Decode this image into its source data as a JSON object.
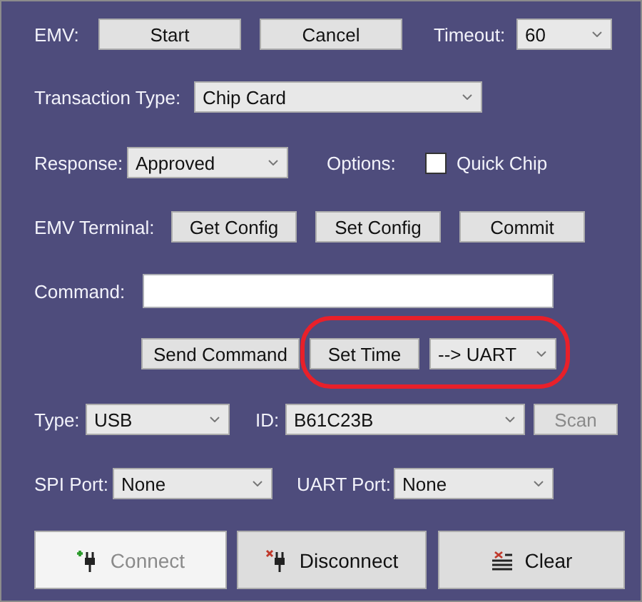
{
  "emv": {
    "label": "EMV:",
    "buttons": [
      {
        "label": "Start",
        "disabled": false
      },
      {
        "label": "Cancel",
        "disabled": false
      }
    ],
    "timeout": {
      "label": "Timeout:",
      "value": "60"
    }
  },
  "transaction_type": {
    "label": "Transaction Type:",
    "value": "Chip Card"
  },
  "response": {
    "label": "Response:",
    "value": "Approved"
  },
  "options": {
    "label": "Options:",
    "checkbox": {
      "label": "Quick Chip",
      "checked": false
    }
  },
  "emv_terminal": {
    "label": "EMV Terminal:",
    "buttons": [
      {
        "label": "Get Config",
        "disabled": false
      },
      {
        "label": "Set Config",
        "disabled": false
      },
      {
        "label": "Commit",
        "disabled": false
      }
    ]
  },
  "command": {
    "label": "Command:"
  },
  "command_actions": {
    "send_button": "Send Command",
    "set_time_button": "Set Time",
    "target": "--> UART",
    "highlighted": true
  },
  "connection": {
    "type": {
      "label": "Type:",
      "value": "USB"
    },
    "id": {
      "label": "ID:",
      "value": "B61C23B"
    },
    "scan": {
      "label": "Scan",
      "disabled": true
    },
    "spi_port": {
      "label": "SPI Port:",
      "value": "None"
    },
    "uart_port": {
      "label": "UART Port:",
      "value": "None"
    }
  },
  "actions": [
    {
      "kind": "connect",
      "label": "Connect",
      "disabled": true
    },
    {
      "kind": "disconnect",
      "label": "Disconnect",
      "disabled": false
    },
    {
      "kind": "clear",
      "label": "Clear",
      "disabled": false
    }
  ]
}
